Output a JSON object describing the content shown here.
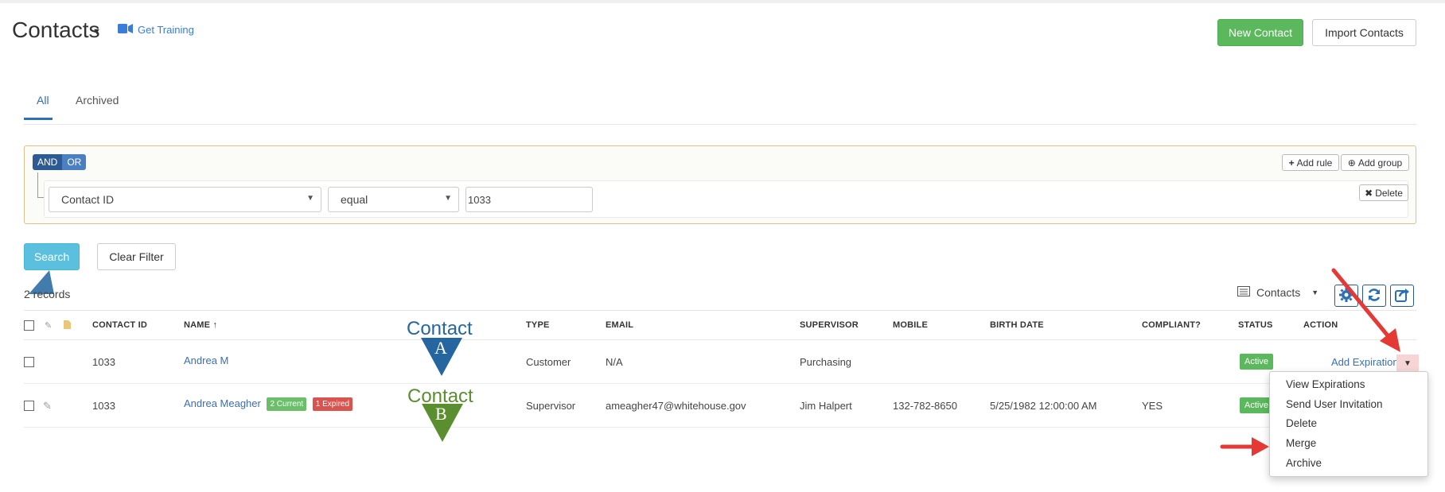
{
  "header": {
    "title": "Contacts",
    "training_label": "Get Training",
    "new_contact_label": "New Contact",
    "import_contacts_label": "Import Contacts"
  },
  "tabs": [
    {
      "label": "All",
      "active": true
    },
    {
      "label": "Archived",
      "active": false
    }
  ],
  "filter": {
    "and_label": "AND",
    "or_label": "OR",
    "add_rule_label": "Add rule",
    "add_group_label": "Add group",
    "delete_label": "Delete",
    "field_value": "Contact ID",
    "operator_value": "equal",
    "input_value": "1033"
  },
  "actions": {
    "search_label": "Search",
    "clear_label": "Clear Filter"
  },
  "records_text": "2 records",
  "view_selector": {
    "label": "Contacts"
  },
  "table": {
    "headers": [
      "CONTACT ID",
      "NAME",
      "TYPE",
      "EMAIL",
      "SUPERVISOR",
      "MOBILE",
      "BIRTH DATE",
      "COMPLIANT?",
      "STATUS",
      "ACTION"
    ],
    "sort_indicator": "↑",
    "rows": [
      {
        "contact_id": "1033",
        "name": "Andrea M",
        "type": "Customer",
        "email": "N/A",
        "supervisor": "Purchasing",
        "mobile": "",
        "birth_date": "",
        "compliant": "",
        "status": "Active",
        "action": "Add Expiration"
      },
      {
        "contact_id": "1033",
        "name": "Andrea Meagher",
        "badge_current": "2 Current",
        "badge_expired": "1 Expired",
        "type": "Supervisor",
        "email": "ameagher47@whitehouse.gov",
        "supervisor": "Jim Halpert",
        "mobile": "132-782-8650",
        "birth_date": "5/25/1982 12:00:00 AM",
        "compliant": "YES",
        "status": "Active"
      }
    ]
  },
  "action_menu": {
    "items": [
      "View Expirations",
      "Send User Invitation",
      "Delete",
      "Merge",
      "Archive"
    ]
  },
  "annotations": {
    "contact_a_word": "Contact",
    "contact_a_letter": "A",
    "contact_b_word": "Contact",
    "contact_b_letter": "B"
  },
  "colors": {
    "primary_link": "#3a6fb0",
    "success": "#5cb85c",
    "info": "#5bc0de",
    "danger": "#d9534f",
    "annotation_arrow": "#e53935",
    "annotation_a": "#2666a0",
    "annotation_b": "#5a8e2e"
  }
}
